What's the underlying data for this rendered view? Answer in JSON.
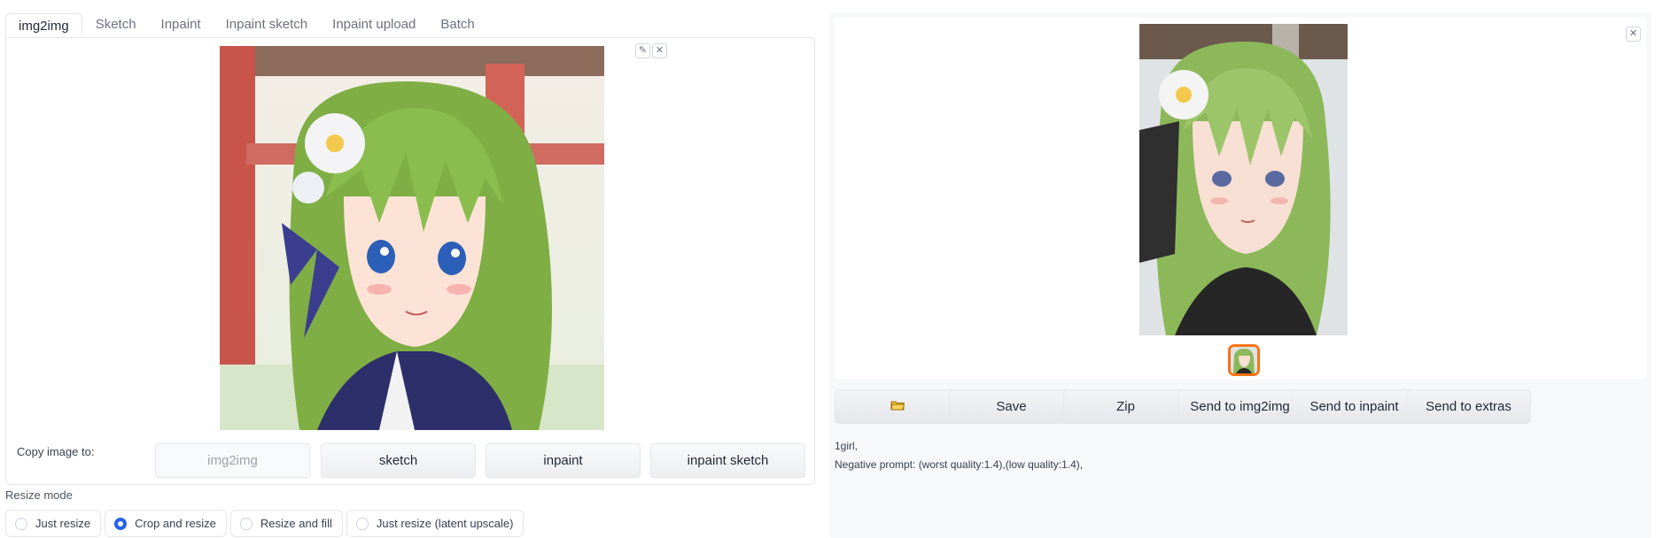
{
  "tabs": [
    "img2img",
    "Sketch",
    "Inpaint",
    "Inpaint sketch",
    "Inpaint upload",
    "Batch"
  ],
  "copy_image": {
    "label": "Copy image to:",
    "buttons": [
      "img2img",
      "sketch",
      "inpaint",
      "inpaint sketch"
    ]
  },
  "resize_mode": {
    "label": "Resize mode",
    "options": [
      "Just resize",
      "Crop and resize",
      "Resize and fill",
      "Just resize (latent upscale)"
    ],
    "selected": "Crop and resize"
  },
  "output": {
    "buttons": [
      "",
      "Save",
      "Zip",
      "Send to img2img",
      "Send to inpaint",
      "Send to extras"
    ],
    "prompt": "1girl,",
    "negative_prompt": "Negative prompt: (worst quality:1.4),(low quality:1.4),"
  },
  "icons": {
    "edit": "pencil-icon",
    "clear": "close-icon",
    "folder": "folder-icon"
  },
  "colors": {
    "accent": "#2563eb",
    "selected_thumb": "#f97316"
  }
}
